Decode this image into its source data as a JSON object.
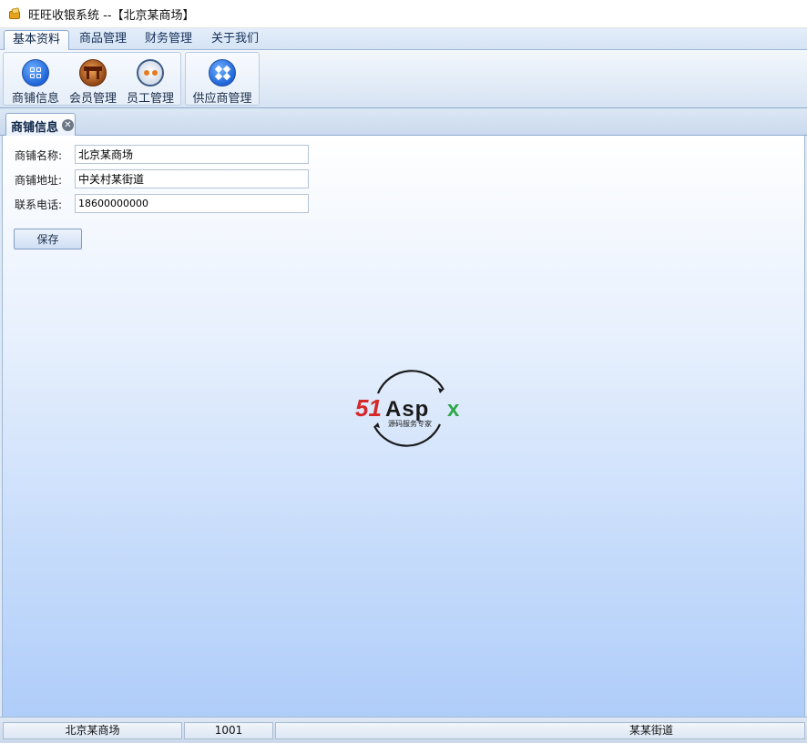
{
  "window": {
    "title": "旺旺收银系统 --【北京某商场】"
  },
  "menu": {
    "tabs": [
      {
        "label": "基本资料",
        "active": true
      },
      {
        "label": "商品管理",
        "active": false
      },
      {
        "label": "财务管理",
        "active": false
      },
      {
        "label": "关于我们",
        "active": false
      }
    ]
  },
  "ribbon": {
    "buttons": [
      {
        "label": "商铺信息",
        "icon": "shop-grid-icon"
      },
      {
        "label": "会员管理",
        "icon": "member-gate-icon"
      },
      {
        "label": "员工管理",
        "icon": "staff-face-icon"
      },
      {
        "label": "供应商管理",
        "icon": "supplier-dropbox-icon"
      }
    ]
  },
  "doc_tab": {
    "label": "商铺信息",
    "close_symbol": "✕"
  },
  "form": {
    "name_label": "商铺名称:",
    "name_value": "北京某商场",
    "address_label": "商铺地址:",
    "address_value": "中关村某街道",
    "phone_label": "联系电话:",
    "phone_value": "18600000000",
    "save_label": "保存"
  },
  "watermark": {
    "brand_red": "51",
    "brand_black": "Asp",
    "brand_green": "x",
    "tagline": "源码服务专家",
    "colors": {
      "red": "#d62828",
      "green": "#2da84a",
      "black": "#1a1a1a"
    }
  },
  "status": {
    "shop": "北京某商场",
    "code": "1001",
    "address": "某某街道"
  },
  "colors": {
    "accent": "#1f64d8",
    "border": "#8eaacd"
  }
}
